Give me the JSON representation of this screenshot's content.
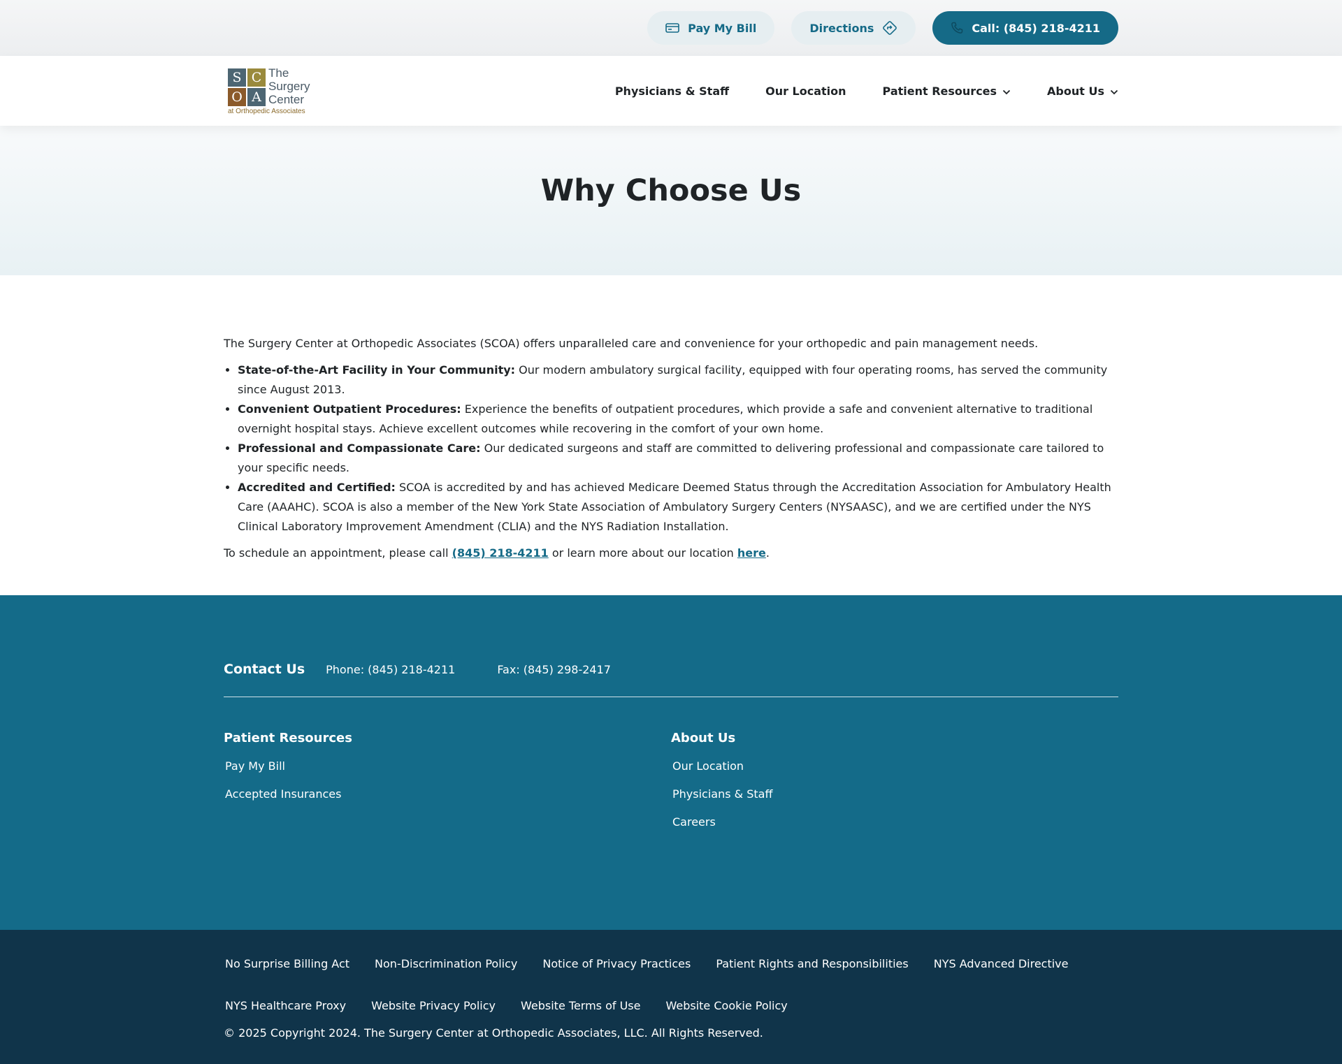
{
  "topbar": {
    "pay_label": "Pay My Bill",
    "directions_label": "Directions",
    "call_label": "Call: (845) 218-4211"
  },
  "header": {
    "logo": {
      "s": "S",
      "c": "C",
      "o": "O",
      "a": "A",
      "line1": "The",
      "line2": "Surgery",
      "line3": "Center",
      "sub": "at Orthopedic Associates"
    },
    "nav": [
      "Physicians & Staff",
      "Our Location",
      "Patient Resources",
      "About Us"
    ]
  },
  "hero": {
    "title": "Why Choose Us"
  },
  "main": {
    "intro": "The Surgery Center at Orthopedic Associates (SCOA) offers unparalleled care and convenience for your orthopedic and pain management needs.",
    "bullets": [
      {
        "title": "State-of-the-Art Facility in Your Community:",
        "text": " Our modern ambulatory surgical facility, equipped with four operating rooms, has served the community since August 2013."
      },
      {
        "title": "Convenient Outpatient Procedures:",
        "text": " Experience the benefits of outpatient procedures, which provide a safe and convenient alternative to traditional overnight hospital stays. Achieve excellent outcomes while recovering in the comfort of your own home."
      },
      {
        "title": "Professional and Compassionate Care:",
        "text": " Our dedicated surgeons and staff are committed to delivering professional and compassionate care tailored to your specific needs."
      },
      {
        "title": "Accredited and Certified:",
        "text": " SCOA is accredited by and has achieved Medicare Deemed Status through the Accreditation Association for Ambulatory Health Care (AAAHC). SCOA is also a member of the New York State Association of Ambulatory Surgery Centers (NYSAASC), and we are certified under the NYS Clinical Laboratory Improvement Amendment (CLIA) and the NYS Radiation Installation."
      }
    ],
    "schedule_prefix": "To schedule an appointment, please call ",
    "schedule_phone": "(845) 218-4211",
    "schedule_mid": " or learn more about our location ",
    "schedule_link": "here",
    "schedule_suffix": "."
  },
  "footer": {
    "contact_title": "Contact Us",
    "phone": "Phone: (845) 218-4211",
    "fax": "Fax: (845) 298-2417",
    "col1": {
      "title": "Patient Resources",
      "links": [
        "Pay My Bill",
        "Accepted Insurances"
      ]
    },
    "col2": {
      "title": "About Us",
      "links": [
        "Our Location",
        "Physicians & Staff",
        "Careers"
      ]
    }
  },
  "bottom": {
    "row1": [
      "No Surprise Billing Act",
      "Non-Discrimination Policy",
      "Notice of Privacy Practices",
      "Patient Rights and Responsibilities",
      "NYS Advanced Directive"
    ],
    "row2": [
      "NYS Healthcare Proxy",
      "Website Privacy Policy",
      "Website Terms of Use",
      "Website Cookie Policy"
    ],
    "copyright": "© 2025 Copyright 2024. The Surgery Center at Orthopedic Associates, LLC. All Rights Reserved."
  },
  "colors": {
    "brand": "#156a87",
    "footer": "#146b89",
    "bottom": "#10344a"
  },
  "icons": [
    "credit-card-icon",
    "directions-icon",
    "phone-icon",
    "chevron-down-icon"
  ]
}
